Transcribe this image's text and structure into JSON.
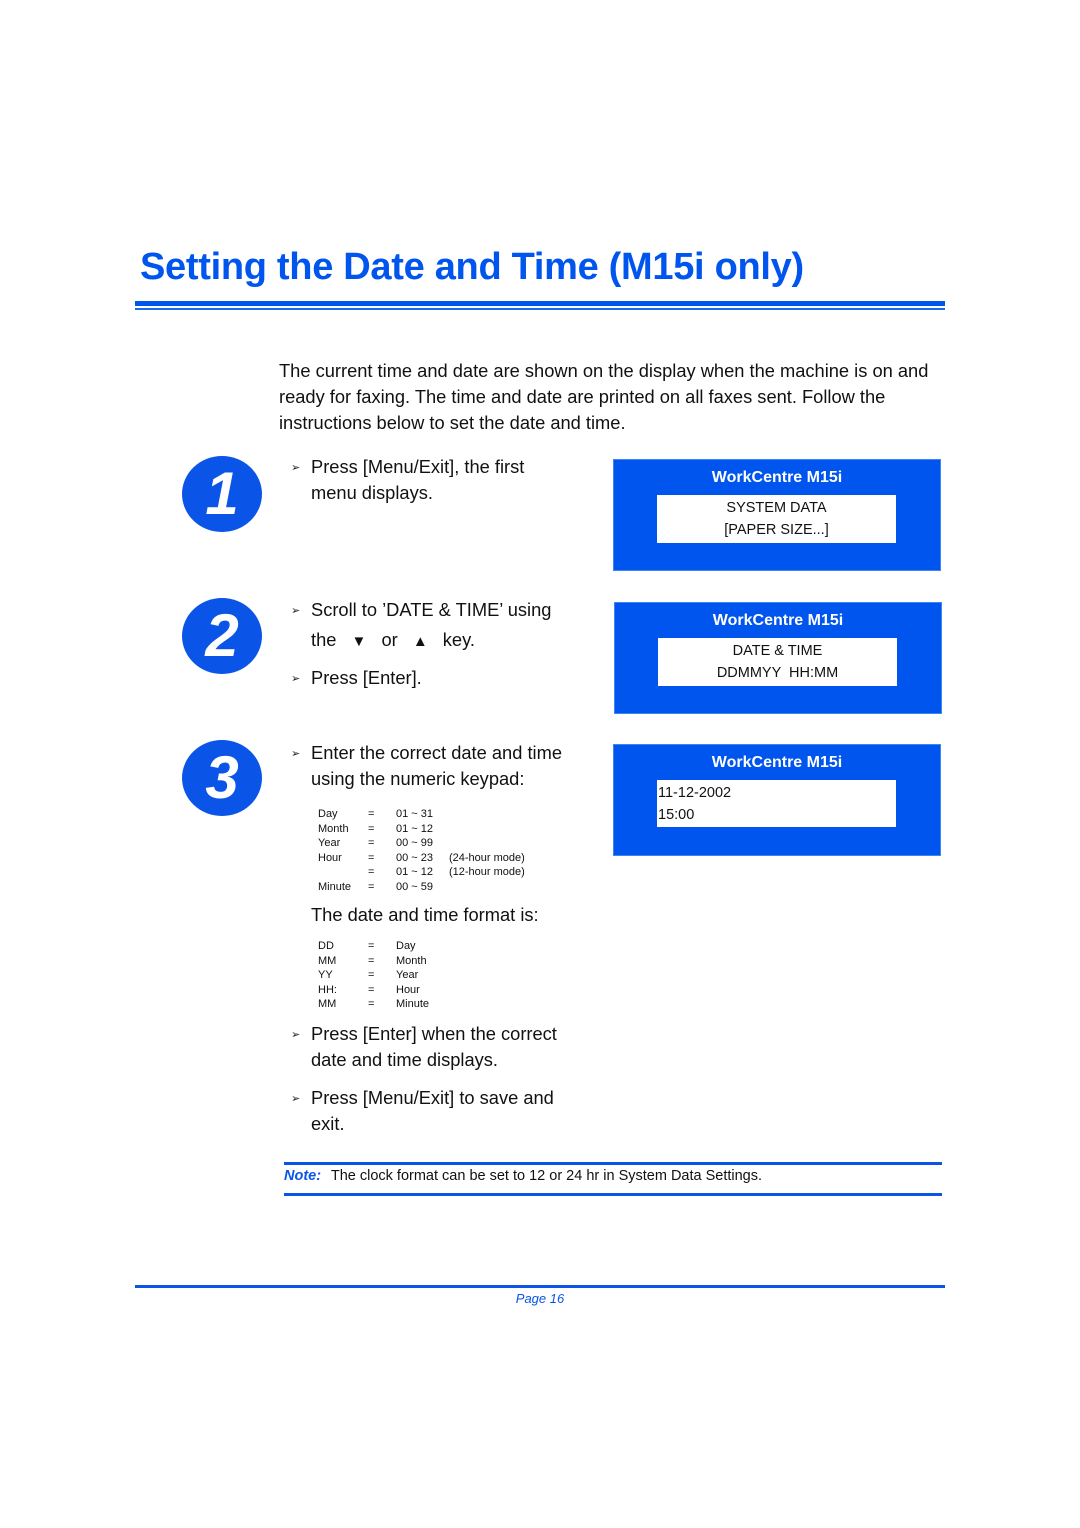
{
  "title": "Setting the Date and Time (M15i only)",
  "intro": "The current time and date are shown on the display when the machine is on and ready for faxing. The time and date are printed on all faxes sent. Follow the instructions below to set the date and time.",
  "bullet_glyph": "➢",
  "steps": [
    {
      "number": "1",
      "bullets": [
        "Press [Menu/Exit], the first menu displays."
      ],
      "display": {
        "title": "WorkCentre M15i",
        "lines": [
          "SYSTEM DATA",
          "[PAPER SIZE...]"
        ]
      }
    },
    {
      "number": "2",
      "bullets": [
        {
          "before": "Scroll to ’DATE & TIME’ using",
          "line2_pre": "the",
          "down_key": "▼",
          "middle": "or",
          "up_key": "▲",
          "after": "key."
        },
        "Press [Enter]."
      ],
      "display": {
        "title": "WorkCentre M15i",
        "lines": [
          "DATE & TIME",
          "DDMMYY  HH:MM"
        ]
      }
    },
    {
      "number": "3",
      "bullets": [
        "Enter the correct date and time using the numeric keypad:",
        "Press [Enter] when the correct date and time displays.",
        "Press [Menu/Exit] to save and exit."
      ],
      "ranges": [
        {
          "field": "Day",
          "eq": "=",
          "range": "01 ~ 31",
          "note": ""
        },
        {
          "field": "Month",
          "eq": "=",
          "range": "01 ~ 12",
          "note": ""
        },
        {
          "field": "Year",
          "eq": "=",
          "range": "00 ~ 99",
          "note": ""
        },
        {
          "field": "Hour",
          "eq": "=",
          "range": "00 ~ 23",
          "note": "(24-hour mode)"
        },
        {
          "field": "",
          "eq": "=",
          "range": "01 ~ 12",
          "note": "(12-hour mode)"
        },
        {
          "field": "Minute",
          "eq": "=",
          "range": "00 ~ 59",
          "note": ""
        }
      ],
      "format_label": "The date and time format is:",
      "format": [
        {
          "code": "DD",
          "eq": "=",
          "meaning": "Day"
        },
        {
          "code": "MM",
          "eq": "=",
          "meaning": "Month"
        },
        {
          "code": "YY",
          "eq": "=",
          "meaning": "Year"
        },
        {
          "code": "HH:",
          "eq": "=",
          "meaning": "Hour"
        },
        {
          "code": "MM",
          "eq": "=",
          "meaning": "Minute"
        }
      ],
      "display": {
        "title": "WorkCentre M15i",
        "lines": [
          "11-12-2002",
          "15:00"
        ]
      }
    }
  ],
  "note": {
    "label": "Note:",
    "text": "The clock format can be set to 12 or 24 hr in System Data Settings."
  },
  "footer": {
    "page": "Page 16"
  },
  "colors": {
    "brand_blue": "#0055ee"
  }
}
